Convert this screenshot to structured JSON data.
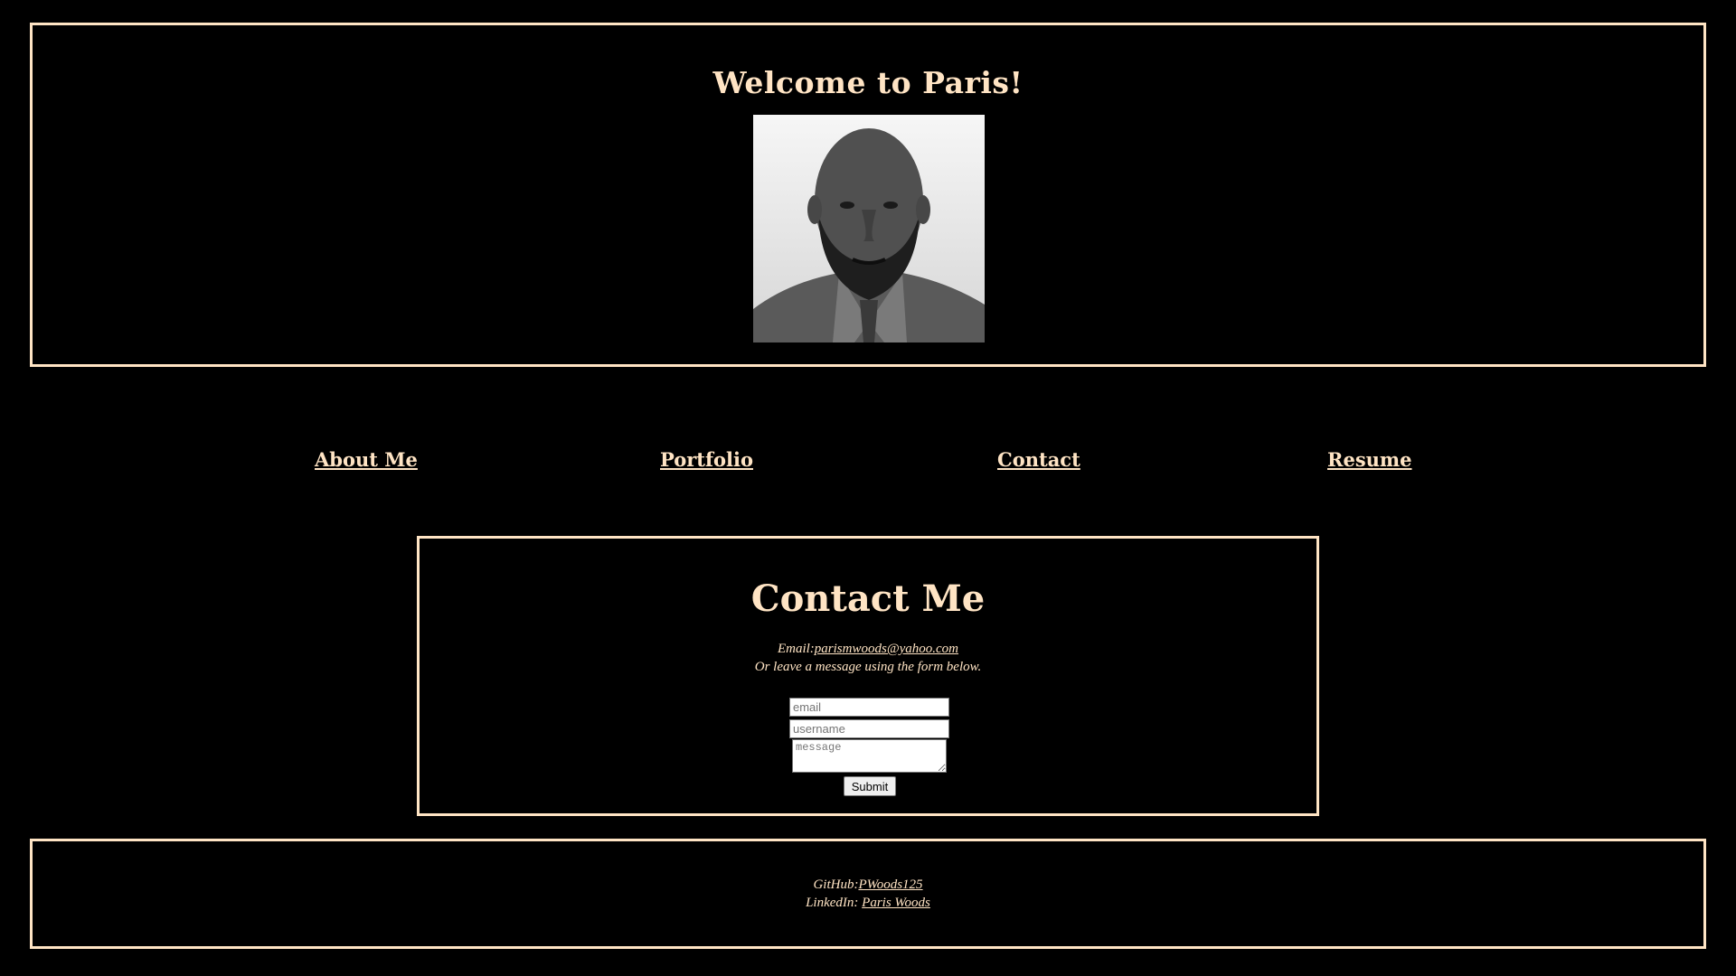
{
  "header": {
    "title": "Welcome to Paris!"
  },
  "nav": {
    "items": [
      {
        "label": "About Me"
      },
      {
        "label": "Portfolio"
      },
      {
        "label": "Contact"
      },
      {
        "label": "Resume"
      }
    ]
  },
  "contact": {
    "title": "Contact Me",
    "email_label": "Email:",
    "email_link": "parismwoods@yahoo.com",
    "form_hint": "Or leave a message using the form below.",
    "email_placeholder": "email",
    "username_placeholder": "username",
    "message_placeholder": "message",
    "submit_label": "Submit"
  },
  "footer": {
    "github_label": "GitHub:",
    "github_link": "PWoods125",
    "linkedin_label": "LinkedIn: ",
    "linkedin_link": "Paris Woods"
  },
  "colors": {
    "background": "#000000",
    "text": "#ffe4c4",
    "border": "#ffe4c4"
  }
}
